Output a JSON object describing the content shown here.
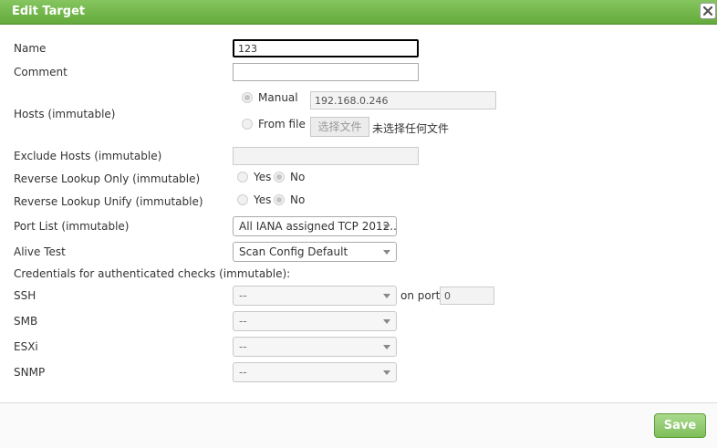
{
  "dialog": {
    "title": "Edit Target",
    "close_icon": "×",
    "save_label": "Save"
  },
  "form": {
    "name": {
      "label": "Name",
      "value": "123"
    },
    "comment": {
      "label": "Comment",
      "value": ""
    },
    "hosts": {
      "label": "Hosts (immutable)",
      "manual_label": "Manual",
      "manual_value": "192.168.0.246",
      "from_file_label": "From file",
      "file_button_label": "选择文件",
      "file_status": "未选择任何文件"
    },
    "exclude_hosts": {
      "label": "Exclude Hosts (immutable)",
      "value": ""
    },
    "reverse_lookup_only": {
      "label": "Reverse Lookup Only (immutable)",
      "yes": "Yes",
      "no": "No"
    },
    "reverse_lookup_unify": {
      "label": "Reverse Lookup Unify (immutable)",
      "yes": "Yes",
      "no": "No"
    },
    "port_list": {
      "label": "Port List (immutable)",
      "value": "All IANA assigned TCP 2012..."
    },
    "alive_test": {
      "label": "Alive Test",
      "value": "Scan Config Default"
    },
    "credentials": {
      "heading": "Credentials for authenticated checks (immutable):",
      "ssh": {
        "label": "SSH",
        "value": "--",
        "on_port_label": "on port",
        "port_value": "0"
      },
      "smb": {
        "label": "SMB",
        "value": "--"
      },
      "esxi": {
        "label": "ESXi",
        "value": "--"
      },
      "snmp": {
        "label": "SNMP",
        "value": "--"
      }
    }
  },
  "colors": {
    "titlebar": "#6db046",
    "save_button": "#8cc86a"
  }
}
